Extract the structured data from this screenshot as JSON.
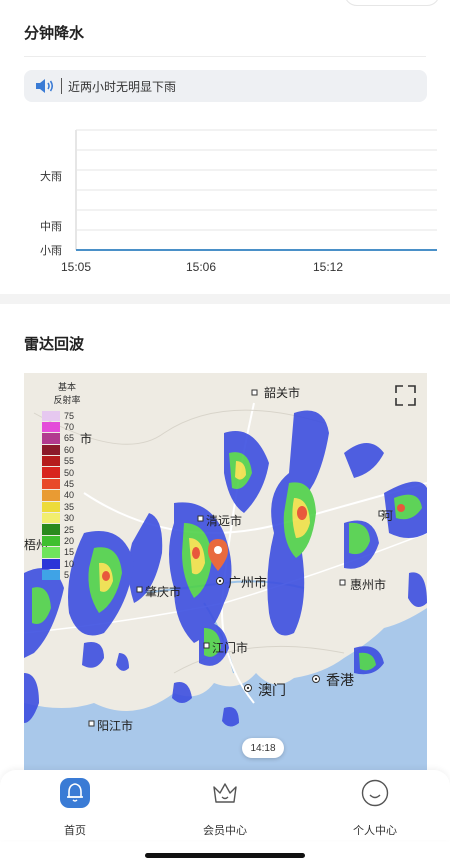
{
  "minute_precip": {
    "title": "分钟降水",
    "notice_text": "近两小时无明显下雨",
    "chart_data": {
      "type": "line",
      "y_levels": [
        "小雨",
        "中雨",
        "大雨"
      ],
      "x_ticks": [
        "15:05",
        "15:06",
        "15:12"
      ],
      "series": [
        {
          "values": [
            0,
            0,
            0,
            0,
            0,
            0,
            0
          ]
        }
      ],
      "grid": true
    }
  },
  "radar": {
    "title": "雷达回波",
    "legend": {
      "title_line1": "基本",
      "title_line2": "反射率",
      "items": [
        {
          "value": "75",
          "color": "#e6c8f0"
        },
        {
          "value": "70",
          "color": "#e44cd9"
        },
        {
          "value": "65",
          "color": "#b23a8f"
        },
        {
          "value": "60",
          "color": "#8b1a2a"
        },
        {
          "value": "55",
          "color": "#b51c1c"
        },
        {
          "value": "50",
          "color": "#d8241e"
        },
        {
          "value": "45",
          "color": "#e8492a"
        },
        {
          "value": "40",
          "color": "#e99b33"
        },
        {
          "value": "35",
          "color": "#eddb3a"
        },
        {
          "value": "30",
          "color": "#f2ee6e"
        },
        {
          "value": "25",
          "color": "#2a8a1e"
        },
        {
          "value": "20",
          "color": "#3fbf2f"
        },
        {
          "value": "15",
          "color": "#6fe45c"
        },
        {
          "value": "10",
          "color": "#2b35d8"
        },
        {
          "value": "5",
          "color": "#3fa3e6"
        }
      ]
    },
    "cities": {
      "shaoguan": "韶关市",
      "qingyuan": "清远市",
      "guangzhou": "广州市",
      "zhaoqing": "肇庆市",
      "huizhou": "惠州市",
      "jiangmen": "江门市",
      "macau": "澳门",
      "hongkong": "香港",
      "yangjiang": "阳江市",
      "heyuan": "河",
      "edge_left_top": "市",
      "edge_left_mid": "梧州"
    },
    "time_label": "14:18"
  },
  "tabbar": {
    "home": "首页",
    "member": "会员中心",
    "profile": "个人中心"
  },
  "colors": {
    "accent": "#3a7bd5",
    "line": "#4a90c8",
    "land": "#eeebe3",
    "sea": "#a9c8ea"
  }
}
